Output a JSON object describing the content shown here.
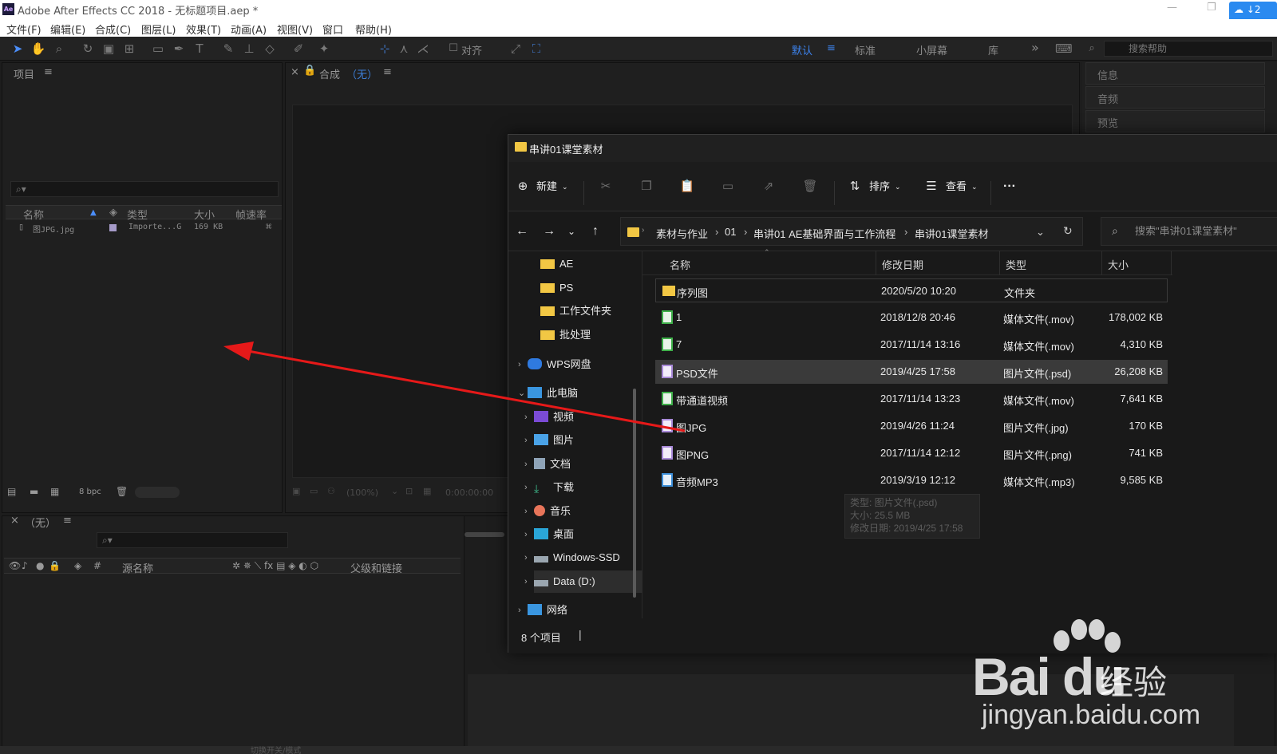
{
  "ae": {
    "window_title": "Adobe After Effects CC 2018 - 无标题项目.aep *",
    "app_badge": "Ae",
    "cloud_label": "↓2",
    "menus": [
      "文件(F)",
      "编辑(E)",
      "合成(C)",
      "图层(L)",
      "效果(T)",
      "动画(A)",
      "视图(V)",
      "窗口",
      "帮助(H)"
    ],
    "toolbar": {
      "align_label": "对齐",
      "workspaces": [
        "默认",
        "标准",
        "小屏幕",
        "库"
      ],
      "overflow": "»",
      "search_placeholder": "搜索帮助"
    },
    "project_panel": {
      "title": "项目",
      "columns": [
        "名称",
        "类型",
        "大小",
        "帧速率"
      ],
      "row": {
        "name": "图JPG.jpg",
        "type": "Importe...G",
        "size": "169 KB"
      },
      "bpc": "8 bpc"
    },
    "comp_panel": {
      "title": "合成",
      "comp_name": "（无）",
      "zoom": "(100%)",
      "timecode": "0:00:00:00"
    },
    "right_panels": [
      "信息",
      "音频",
      "预览"
    ],
    "timeline": {
      "title": "（无）",
      "source_name_col": "源名称",
      "parent_col": "父级和链接",
      "switch_label": "切换开关/模式"
    }
  },
  "explorer": {
    "title": "串讲01课堂素材",
    "commands": {
      "new": "新建",
      "sort": "排序",
      "view": "查看",
      "more": "···"
    },
    "breadcrumb": [
      "素材与作业",
      "01",
      "串讲01 AE基础界面与工作流程",
      "串讲01课堂素材"
    ],
    "search_placeholder": "搜索\"串讲01课堂素材\"",
    "sidebar": [
      {
        "label": "AE",
        "icon": "folder-icon"
      },
      {
        "label": "PS",
        "icon": "folder-icon"
      },
      {
        "label": "工作文件夹",
        "icon": "folder-icon"
      },
      {
        "label": "批处理",
        "icon": "folder-icon"
      },
      {
        "label": "WPS网盘",
        "icon": "cloud-icon"
      },
      {
        "label": "此电脑",
        "icon": "computer-icon"
      },
      {
        "label": "视频",
        "icon": "video-icon"
      },
      {
        "label": "图片",
        "icon": "picture-icon"
      },
      {
        "label": "文档",
        "icon": "document-icon"
      },
      {
        "label": "下载",
        "icon": "download-icon"
      },
      {
        "label": "音乐",
        "icon": "music-icon"
      },
      {
        "label": "桌面",
        "icon": "desktop-icon"
      },
      {
        "label": "Windows-SSD",
        "icon": "drive-icon"
      },
      {
        "label": "Data (D:)",
        "icon": "drive-icon"
      },
      {
        "label": "网络",
        "icon": "network-icon"
      }
    ],
    "columns": [
      "名称",
      "修改日期",
      "类型",
      "大小"
    ],
    "files": [
      {
        "name": "序列图",
        "date": "2020/5/20 10:20",
        "type": "文件夹",
        "size": "",
        "icon": "folder-icon"
      },
      {
        "name": "1",
        "date": "2018/12/8 20:46",
        "type": "媒体文件(.mov)",
        "size": "178,002 KB",
        "icon": "video-file-icon"
      },
      {
        "name": "7",
        "date": "2017/11/14 13:16",
        "type": "媒体文件(.mov)",
        "size": "4,310 KB",
        "icon": "video-file-icon"
      },
      {
        "name": "PSD文件",
        "date": "2019/4/25 17:58",
        "type": "图片文件(.psd)",
        "size": "26,208 KB",
        "icon": "image-file-icon"
      },
      {
        "name": "带通道视频",
        "date": "2017/11/14 13:23",
        "type": "媒体文件(.mov)",
        "size": "7,641 KB",
        "icon": "video-file-icon"
      },
      {
        "name": "图JPG",
        "date": "2019/4/26 11:24",
        "type": "图片文件(.jpg)",
        "size": "170 KB",
        "icon": "image-file-icon"
      },
      {
        "name": "图PNG",
        "date": "2017/11/14 12:12",
        "type": "图片文件(.png)",
        "size": "741 KB",
        "icon": "image-file-icon"
      },
      {
        "name": "音频MP3",
        "date": "2019/3/19 12:12",
        "type": "媒体文件(.mp3)",
        "size": "9,585 KB",
        "icon": "audio-file-icon"
      }
    ],
    "tooltip": {
      "line1": "类型: 图片文件(.psd)",
      "line2": "大小: 25.5 MB",
      "line3": "修改日期: 2019/4/25 17:58"
    },
    "status": "8 个项目",
    "colors": {
      "folder": "#f2c744",
      "selection": "#3a3a3a",
      "arrow": "#e61919"
    }
  },
  "watermark": {
    "logo": "Bai du",
    "suffix": "经验",
    "url": "jingyan.baidu.com"
  }
}
